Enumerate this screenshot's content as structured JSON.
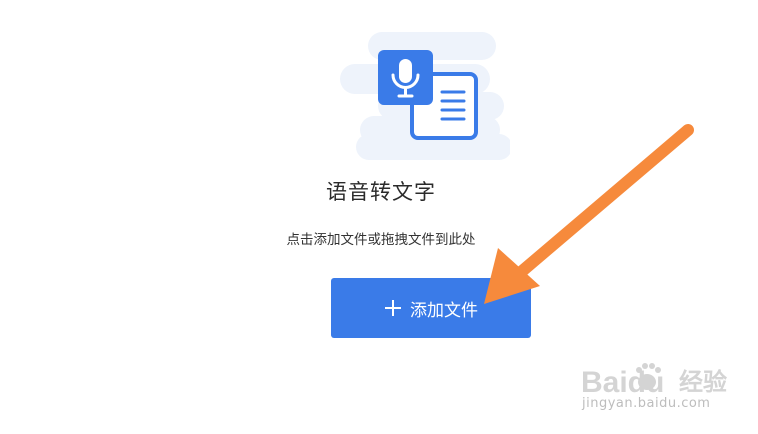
{
  "main": {
    "title": "语音转文字",
    "subtitle": "点击添加文件或拖拽文件到此处",
    "add_button_label": "添加文件"
  },
  "watermark": {
    "brand": "Baidu",
    "brand_suffix": "经验",
    "url": "jingyan.baidu.com"
  },
  "icons": {
    "illustration": "speech-to-text-illustration-icon",
    "plus": "plus-icon",
    "annotation": "orange-arrow-annotation"
  },
  "colors": {
    "accent": "#3a7be8",
    "illustration_bg": "#eef3fb",
    "arrow": "#f68a3c"
  }
}
